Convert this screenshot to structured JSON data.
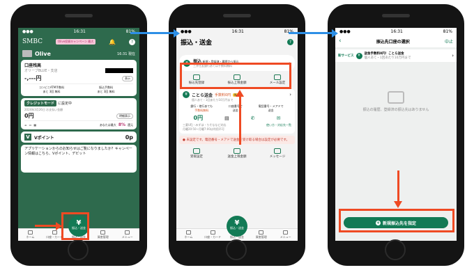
{
  "status": {
    "time": "16:31",
    "battery": "81%"
  },
  "screen1": {
    "brand": "SMBC",
    "banner": "Olive投資キャンペーン 最大",
    "banner_sub": "Vポイント抽選キャンペーン",
    "card_name": "Olive",
    "updated": "16:31 現在",
    "balance_title": "口座残高",
    "account": "オリーブBLUE・支店",
    "balance_masked": "-,---円",
    "show": "表示",
    "atm_fee_label": "コンビニATM手数料",
    "atm_fee_value": "あと 3回 無料",
    "transfer_fee_label": "振込手数料",
    "transfer_fee_value": "あと 3回 無料",
    "credit_mode": "クレジットモード",
    "credit_setting": "に設定中",
    "payment_date": "2024年3月26日 お支払い金額",
    "amount": "0円",
    "details": "明細表示",
    "reward_label": "あなたは最大",
    "reward_value": "8%",
    "reward_action": "還元",
    "vpoint_label": "Vポイント",
    "vpoint_value": "0p",
    "notice": "アプリケーションからのお知らせはご覧になりましたか？キャンペーン情報はこちら、Vポイント、デビット"
  },
  "screen2": {
    "title": "振込・送金",
    "transfer_title": "振込",
    "transfer_desc": "新規・登録済・履歴から振込",
    "transfer_note": "三井住友銀行あては手数料無料",
    "actions": [
      "振込先登録",
      "振込上限金額",
      "メール設定"
    ],
    "kotora_title": "ことら送金",
    "kotora_fee": "手数料0円",
    "kotora_new": "New",
    "kotora_desc": "個人あて・1回あたり10万円まで",
    "opts": [
      "銀行・他行あても",
      "口座番号で",
      "電話番号・メアドで"
    ],
    "opts2": [
      "手数料無料",
      "送金",
      "送金"
    ],
    "fee": "0円",
    "notes": [
      "三菱UFJ・みずほ・りそななど対応",
      "月曜20:50~月曜7:00は利用不可"
    ],
    "partners": "使い方・対応先一覧",
    "warning": "未設定です。電話番号・メアドで送金を受け取る場合は設定が必要です。",
    "bottom_actions": [
      "受取設定",
      "送金上限金額",
      "メッセージ"
    ]
  },
  "screen3": {
    "title": "振込先口座の選択",
    "cancel": "中止",
    "new_service": "新サービス",
    "promo_title": "送金手数料0円！ことら送金",
    "promo_desc": "個人あて・1回あたり10万円まで",
    "empty": "振込の履歴、登録済の振込先はありません",
    "cta": "新規振込先を指定"
  },
  "tabs1": [
    "ホーム",
    "口座・カード",
    "振込・送金",
    "資産管理",
    "メニュー"
  ],
  "tabs2": [
    "ホーム",
    "口座・カード",
    "振込・送金",
    "資産管理",
    "メニュー"
  ],
  "fab_label": "振込・送金",
  "colors": {
    "accent": "#127a55",
    "highlight": "#ef4a23",
    "flow": "#2d8fe6"
  }
}
